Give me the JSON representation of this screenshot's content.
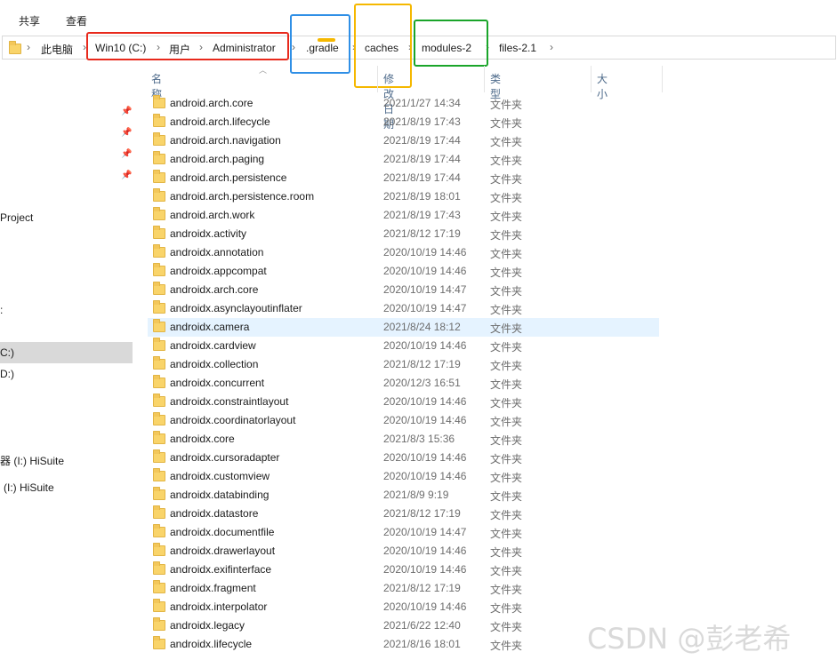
{
  "ribbon": {
    "tabs": [
      "共享",
      "查看"
    ]
  },
  "address_bar": {
    "crumbs": [
      "此电脑",
      "Win10 (C:)",
      "用户",
      "Administrator",
      ".gradle",
      "caches",
      "modules-2",
      "files-2.1"
    ]
  },
  "annotation_colors": {
    "red": "#e8291c",
    "blue": "#2f8fe6",
    "yellow": "#f5b800",
    "green": "#1aa52a"
  },
  "sidebar": {
    "items": [
      "Project",
      ":",
      "C:)",
      "D:)",
      "器 (I:) HiSuite",
      "(I:) HiSuite"
    ],
    "selected_index": 2
  },
  "columns": {
    "name": "名称",
    "date": "修改日期",
    "type": "类型",
    "size": "大小"
  },
  "files": [
    {
      "name": "android.arch.core",
      "date": "2021/1/27 14:34",
      "type": "文件夹"
    },
    {
      "name": "android.arch.lifecycle",
      "date": "2021/8/19 17:43",
      "type": "文件夹"
    },
    {
      "name": "android.arch.navigation",
      "date": "2021/8/19 17:44",
      "type": "文件夹"
    },
    {
      "name": "android.arch.paging",
      "date": "2021/8/19 17:44",
      "type": "文件夹"
    },
    {
      "name": "android.arch.persistence",
      "date": "2021/8/19 17:44",
      "type": "文件夹"
    },
    {
      "name": "android.arch.persistence.room",
      "date": "2021/8/19 18:01",
      "type": "文件夹"
    },
    {
      "name": "android.arch.work",
      "date": "2021/8/19 17:43",
      "type": "文件夹"
    },
    {
      "name": "androidx.activity",
      "date": "2021/8/12 17:19",
      "type": "文件夹"
    },
    {
      "name": "androidx.annotation",
      "date": "2020/10/19 14:46",
      "type": "文件夹"
    },
    {
      "name": "androidx.appcompat",
      "date": "2020/10/19 14:46",
      "type": "文件夹"
    },
    {
      "name": "androidx.arch.core",
      "date": "2020/10/19 14:47",
      "type": "文件夹"
    },
    {
      "name": "androidx.asynclayoutinflater",
      "date": "2020/10/19 14:47",
      "type": "文件夹"
    },
    {
      "name": "androidx.camera",
      "date": "2021/8/24 18:12",
      "type": "文件夹",
      "highlighted": true
    },
    {
      "name": "androidx.cardview",
      "date": "2020/10/19 14:46",
      "type": "文件夹"
    },
    {
      "name": "androidx.collection",
      "date": "2021/8/12 17:19",
      "type": "文件夹"
    },
    {
      "name": "androidx.concurrent",
      "date": "2020/12/3 16:51",
      "type": "文件夹"
    },
    {
      "name": "androidx.constraintlayout",
      "date": "2020/10/19 14:46",
      "type": "文件夹"
    },
    {
      "name": "androidx.coordinatorlayout",
      "date": "2020/10/19 14:46",
      "type": "文件夹"
    },
    {
      "name": "androidx.core",
      "date": "2021/8/3 15:36",
      "type": "文件夹"
    },
    {
      "name": "androidx.cursoradapter",
      "date": "2020/10/19 14:46",
      "type": "文件夹"
    },
    {
      "name": "androidx.customview",
      "date": "2020/10/19 14:46",
      "type": "文件夹"
    },
    {
      "name": "androidx.databinding",
      "date": "2021/8/9 9:19",
      "type": "文件夹"
    },
    {
      "name": "androidx.datastore",
      "date": "2021/8/12 17:19",
      "type": "文件夹"
    },
    {
      "name": "androidx.documentfile",
      "date": "2020/10/19 14:47",
      "type": "文件夹"
    },
    {
      "name": "androidx.drawerlayout",
      "date": "2020/10/19 14:46",
      "type": "文件夹"
    },
    {
      "name": "androidx.exifinterface",
      "date": "2020/10/19 14:46",
      "type": "文件夹"
    },
    {
      "name": "androidx.fragment",
      "date": "2021/8/12 17:19",
      "type": "文件夹"
    },
    {
      "name": "androidx.interpolator",
      "date": "2020/10/19 14:46",
      "type": "文件夹"
    },
    {
      "name": "androidx.legacy",
      "date": "2021/6/22 12:40",
      "type": "文件夹"
    },
    {
      "name": "androidx.lifecycle",
      "date": "2021/8/16 18:01",
      "type": "文件夹"
    }
  ],
  "watermark": "CSDN @彭老希"
}
